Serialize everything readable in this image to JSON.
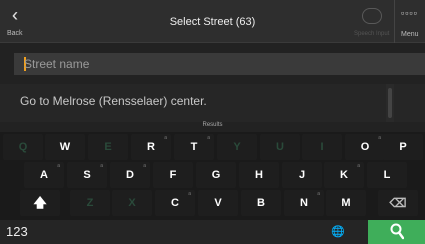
{
  "header": {
    "back_label": "Back",
    "title": "Select Street (63)",
    "speech_label": "Speech Input",
    "menu_label": "Menu",
    "menu_glyph": "▫▫▫▫"
  },
  "search": {
    "placeholder": "Street name",
    "value": ""
  },
  "results": {
    "items": [
      "Go to Melrose (Rensselaer) center."
    ],
    "tab_label": "Results"
  },
  "keyboard": {
    "row1": [
      {
        "key": "Q",
        "sup": "",
        "enabled": false
      },
      {
        "key": "W",
        "sup": "",
        "enabled": true
      },
      {
        "key": "E",
        "sup": "",
        "enabled": false
      },
      {
        "key": "R",
        "sup": "a",
        "enabled": true
      },
      {
        "key": "T",
        "sup": "a",
        "enabled": true
      },
      {
        "key": "Y",
        "sup": "",
        "enabled": false
      },
      {
        "key": "U",
        "sup": "",
        "enabled": false
      },
      {
        "key": "I",
        "sup": "",
        "enabled": false
      },
      {
        "key": "O",
        "sup": "a",
        "enabled": true
      },
      {
        "key": "P",
        "sup": "",
        "enabled": true
      }
    ],
    "row2": [
      {
        "key": "A",
        "sup": "a",
        "enabled": true
      },
      {
        "key": "S",
        "sup": "a",
        "enabled": true
      },
      {
        "key": "D",
        "sup": "a",
        "enabled": true
      },
      {
        "key": "F",
        "sup": "",
        "enabled": true
      },
      {
        "key": "G",
        "sup": "",
        "enabled": true
      },
      {
        "key": "H",
        "sup": "",
        "enabled": true
      },
      {
        "key": "J",
        "sup": "",
        "enabled": true
      },
      {
        "key": "K",
        "sup": "a",
        "enabled": true
      },
      {
        "key": "L",
        "sup": "",
        "enabled": true
      }
    ],
    "row3": [
      {
        "key": "Z",
        "sup": "",
        "enabled": false
      },
      {
        "key": "X",
        "sup": "",
        "enabled": false
      },
      {
        "key": "C",
        "sup": "a",
        "enabled": true
      },
      {
        "key": "V",
        "sup": "",
        "enabled": true
      },
      {
        "key": "B",
        "sup": "",
        "enabled": true
      },
      {
        "key": "N",
        "sup": "a",
        "enabled": true
      },
      {
        "key": "M",
        "sup": "",
        "enabled": true
      }
    ],
    "shift_glyph": "🡅",
    "backspace_glyph": "⌫",
    "numbers_label": "123",
    "globe_glyph": "🌐"
  },
  "colors": {
    "accent": "#3fae5a",
    "cursor": "#f0a020"
  }
}
